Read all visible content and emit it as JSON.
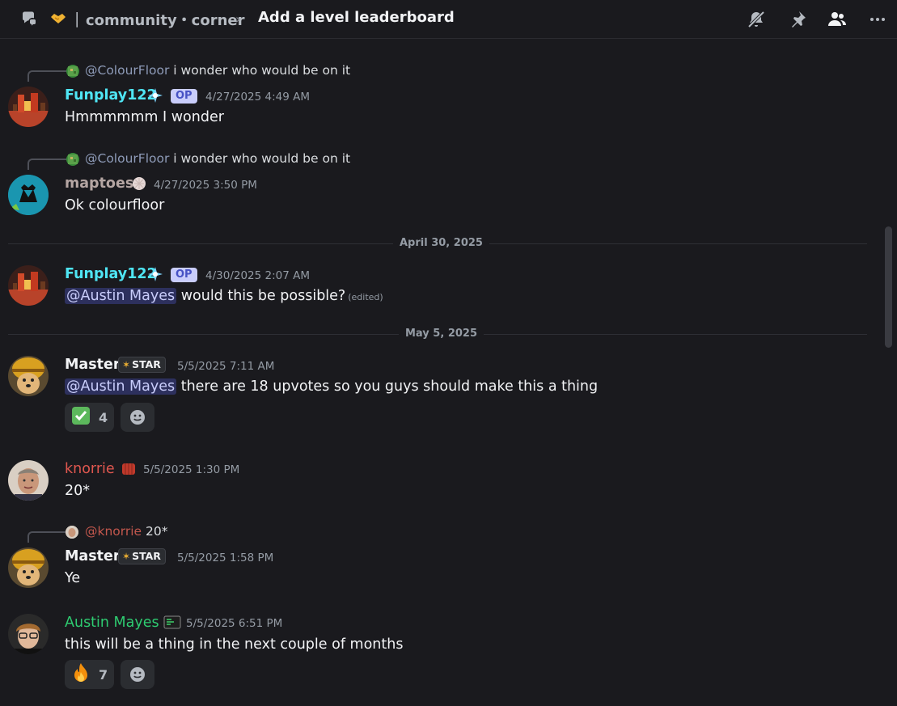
{
  "header": {
    "server_emoji": "handshake-emoji",
    "separator": "|",
    "channel_name": "community・corner",
    "chevron": "›",
    "thread_title": "Add a level leaderboard",
    "icons": [
      "thread-icon",
      "mute-bell-icon",
      "pin-icon",
      "members-icon",
      "more-icon"
    ]
  },
  "messages": [
    {
      "reply": {
        "name": "@ColourFloor",
        "text": "i wonder who would be on it"
      },
      "author": "Funplay122",
      "author_color": "#4fe6f5",
      "badge": "OP",
      "timestamp": "4/27/2025 4:49 AM",
      "text": "Hmmmmmm I wonder"
    },
    {
      "reply": {
        "name": "@ColourFloor",
        "text": "i wonder who would be on it"
      },
      "author": "maptoes",
      "author_color": "#b5a6a3",
      "timestamp": "4/27/2025 3:50 PM",
      "text": "Ok colourfloor"
    },
    {
      "author": "Funplay122",
      "author_color": "#4fe6f5",
      "badge": "OP",
      "timestamp": "4/30/2025 2:07 AM",
      "mention": "@Austin Mayes",
      "text": "would this be possible?",
      "edited": "(edited)"
    },
    {
      "author": "Master",
      "author_color": "#f2f3f5",
      "badge": "STAR",
      "timestamp": "5/5/2025 7:11 AM",
      "mention": "@Austin Mayes",
      "text": "there are 18 upvotes so you guys should make this a thing",
      "reaction": {
        "emoji": "✅",
        "count": "4"
      }
    },
    {
      "author": "knorrie",
      "author_color": "#e0574f",
      "timestamp": "5/5/2025 1:30 PM",
      "text": "20*"
    },
    {
      "reply": {
        "name": "@knorrie",
        "text": "20*"
      },
      "author": "Master",
      "author_color": "#f2f3f5",
      "badge": "STAR",
      "timestamp": "5/5/2025 1:58 PM",
      "text": "Ye"
    },
    {
      "author": "Austin Mayes",
      "author_color": "#2ecc71",
      "timestamp": "5/5/2025 6:51 PM",
      "text": "this will be a thing in the next couple of months",
      "reaction": {
        "emoji": "🔥",
        "count": "7"
      }
    }
  ],
  "dividers": [
    "April 30, 2025",
    "May 5, 2025"
  ]
}
